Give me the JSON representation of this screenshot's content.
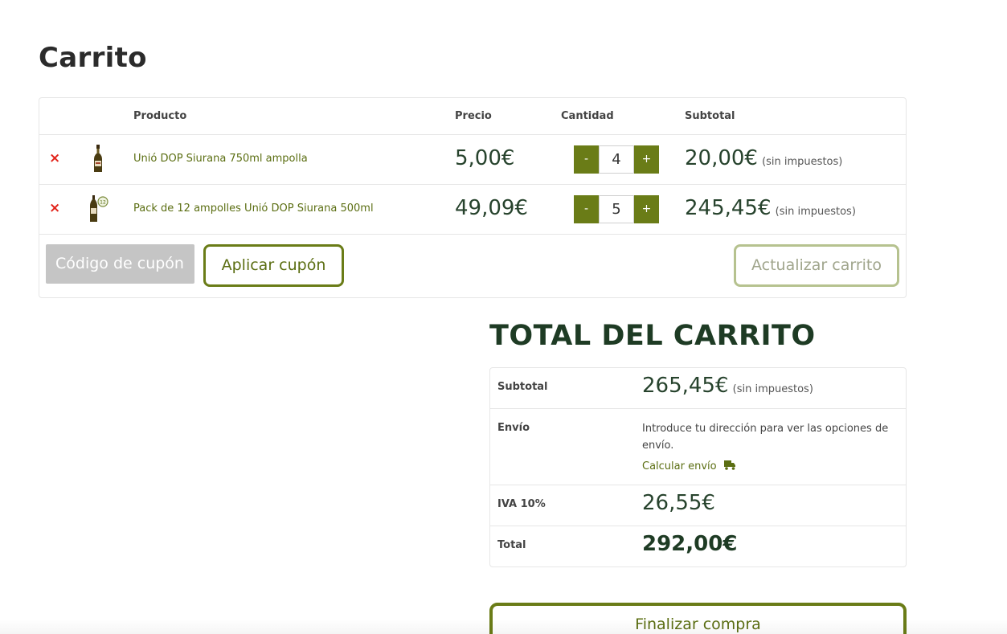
{
  "page": {
    "title": "Carrito"
  },
  "cart": {
    "headers": {
      "product": "Producto",
      "price": "Precio",
      "quantity": "Cantidad",
      "subtotal": "Subtotal"
    },
    "remove_symbol": "×",
    "qty_minus": "-",
    "qty_plus": "+",
    "items": [
      {
        "name": "Unió DOP Siurana 750ml ampolla",
        "price": "5,00€",
        "quantity": "4",
        "subtotal": "20,00€",
        "tax_note": "(sin impuestos)",
        "thumb_icon": "olive-oil-bottle-icon"
      },
      {
        "name": "Pack de 12 ampolles Unió DOP Siurana 500ml",
        "price": "49,09€",
        "quantity": "5",
        "subtotal": "245,45€",
        "tax_note": "(sin impuestos)",
        "thumb_icon": "olive-oil-pack-icon"
      }
    ],
    "coupon_placeholder": "Código de cupón",
    "apply_coupon_label": "Aplicar cupón",
    "update_cart_label": "Actualizar carrito"
  },
  "totals": {
    "title": "TOTAL DEL CARRITO",
    "subtotal_label": "Subtotal",
    "subtotal_value": "265,45€",
    "subtotal_tax_note": "(sin impuestos)",
    "shipping_label": "Envío",
    "shipping_text": "Introduce tu dirección para ver las opciones de envío.",
    "calc_shipping_label": "Calcular envío",
    "calc_shipping_icon": "truck-icon",
    "vat_label": "IVA 10%",
    "vat_value": "26,55€",
    "total_label": "Total",
    "total_value": "292,00€"
  },
  "checkout_label": "Finalizar compra",
  "colors": {
    "accent": "#6a7c17",
    "link": "#5b6e12",
    "price_text": "#27432d",
    "heading_dark": "#1e3b24",
    "remove": "#e2231a",
    "coupon_bg": "#c5c5c5"
  }
}
